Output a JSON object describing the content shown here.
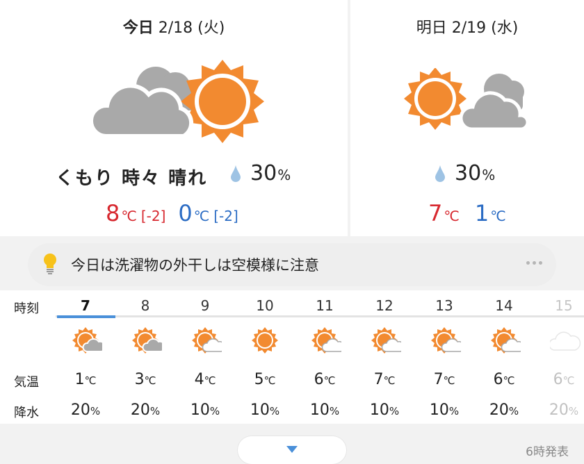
{
  "today": {
    "label_prefix": "今日",
    "date": "2/18",
    "weekday": "(火)",
    "condition": "くもり 時々 晴れ",
    "precip": "30",
    "precip_unit": "%",
    "high": "8",
    "high_unit": "℃",
    "high_diff": "[-2]",
    "low": "0",
    "low_unit": "℃",
    "low_diff": "[-2]",
    "icon": "cloud-then-sun-icon"
  },
  "tomorrow": {
    "label_prefix": "明日",
    "date": "2/19",
    "weekday": "(水)",
    "precip": "30",
    "precip_unit": "%",
    "high": "7",
    "high_unit": "℃",
    "low": "1",
    "low_unit": "℃",
    "icon": "sun-then-cloud-icon"
  },
  "advice": {
    "text": "今日は洗濯物の外干しは空模様に注意",
    "icon": "lightbulb-icon"
  },
  "hourly": {
    "label_time": "時刻",
    "label_temp": "気温",
    "label_precip": "降水",
    "temp_unit": "℃",
    "precip_unit": "%",
    "hours": [
      {
        "hour": "7",
        "temp": "1",
        "precip": "20",
        "icon": "sun-cloud-gray-icon"
      },
      {
        "hour": "8",
        "temp": "3",
        "precip": "20",
        "icon": "sun-cloud-gray-icon"
      },
      {
        "hour": "9",
        "temp": "4",
        "precip": "10",
        "icon": "sun-cloud-white-icon"
      },
      {
        "hour": "10",
        "temp": "5",
        "precip": "10",
        "icon": "sun-icon"
      },
      {
        "hour": "11",
        "temp": "6",
        "precip": "10",
        "icon": "sun-cloud-white-icon"
      },
      {
        "hour": "12",
        "temp": "7",
        "precip": "10",
        "icon": "sun-cloud-white-icon"
      },
      {
        "hour": "13",
        "temp": "7",
        "precip": "10",
        "icon": "sun-cloud-white-icon"
      },
      {
        "hour": "14",
        "temp": "6",
        "precip": "20",
        "icon": "sun-cloud-white-icon"
      },
      {
        "hour": "15",
        "temp": "6",
        "precip": "20",
        "icon": "cloud-icon"
      }
    ]
  },
  "footer": {
    "issued": "6時発表",
    "expand_icon": "chevron-down-icon"
  },
  "colors": {
    "high": "#d7282f",
    "low": "#2b6cc4",
    "accent": "#4a90d9",
    "sun": "#f28a30"
  }
}
